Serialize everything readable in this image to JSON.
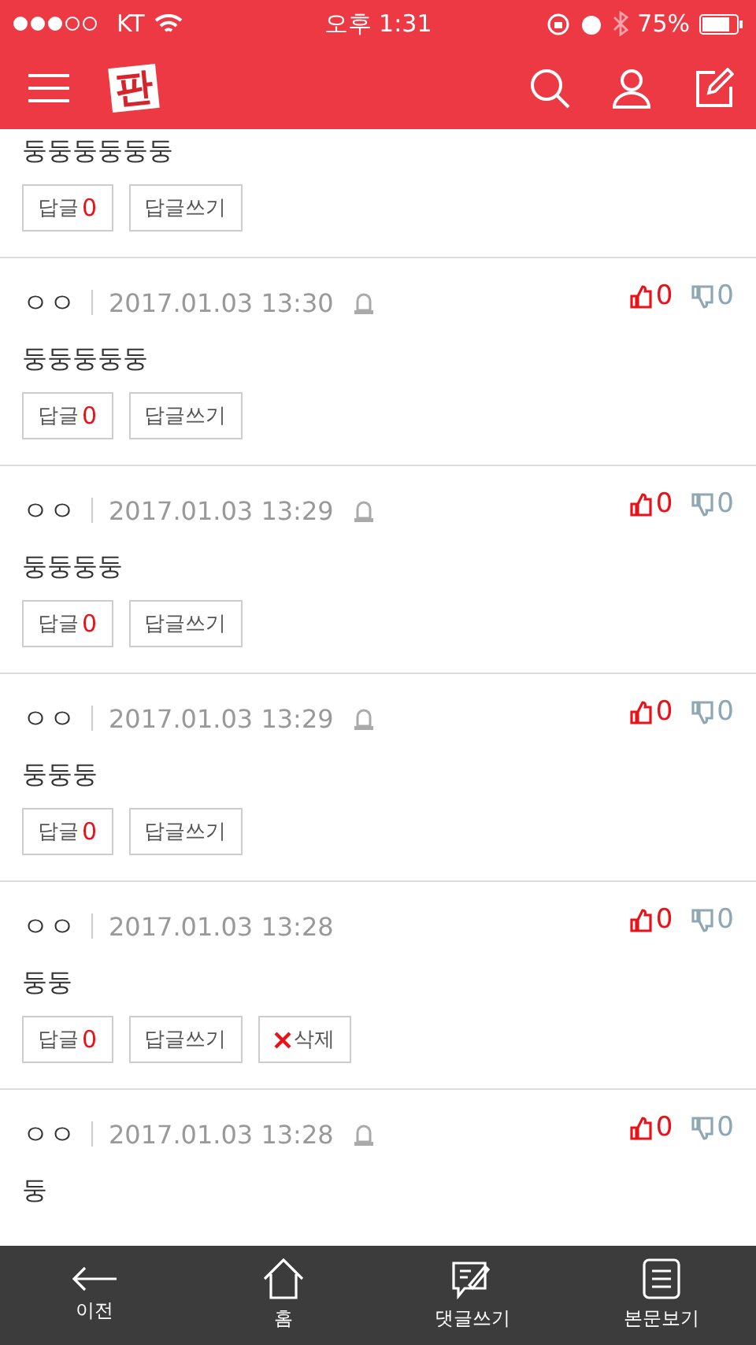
{
  "status_bar": {
    "carrier": "KT",
    "time": "오후 1:31",
    "battery": "75%"
  },
  "header": {
    "logo": "판"
  },
  "comments": [
    {
      "kind": "partial",
      "body": "둥둥둥둥둥둥",
      "reply_label": "답글",
      "reply_count": "0",
      "write_reply": "답글쓰기"
    },
    {
      "kind": "full",
      "author": "ㅇㅇ",
      "date": "2017.01.03 13:30",
      "body": "둥둥둥둥둥",
      "likes": "0",
      "dislikes": "0",
      "reply_label": "답글",
      "reply_count": "0",
      "write_reply": "답글쓰기",
      "own": false
    },
    {
      "kind": "full",
      "author": "ㅇㅇ",
      "date": "2017.01.03 13:29",
      "body": "둥둥둥둥",
      "likes": "0",
      "dislikes": "0",
      "reply_label": "답글",
      "reply_count": "0",
      "write_reply": "답글쓰기",
      "own": false
    },
    {
      "kind": "full",
      "author": "ㅇㅇ",
      "date": "2017.01.03 13:29",
      "body": "둥둥둥",
      "likes": "0",
      "dislikes": "0",
      "reply_label": "답글",
      "reply_count": "0",
      "write_reply": "답글쓰기",
      "own": false
    },
    {
      "kind": "full",
      "author": "ㅇㅇ",
      "date": "2017.01.03 13:28",
      "body": "둥둥",
      "likes": "0",
      "dislikes": "0",
      "reply_label": "답글",
      "reply_count": "0",
      "write_reply": "답글쓰기",
      "own": true,
      "delete_label": "삭제"
    },
    {
      "kind": "full",
      "author": "ㅇㅇ",
      "date": "2017.01.03 13:28",
      "body": "둥",
      "likes": "0",
      "dislikes": "0",
      "own": false
    }
  ],
  "bottom_nav": [
    {
      "kind": "back",
      "label": "이전"
    },
    {
      "kind": "home",
      "label": "홈"
    },
    {
      "kind": "comment",
      "label": "댓글쓰기"
    },
    {
      "kind": "article",
      "label": "본문보기"
    }
  ]
}
